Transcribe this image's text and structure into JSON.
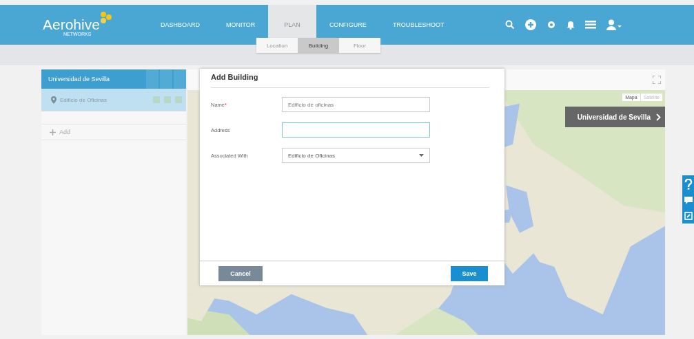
{
  "brand": {
    "name": "Aerohive",
    "tagline": "NETWORKS"
  },
  "nav": [
    {
      "label": "DASHBOARD",
      "selected": false
    },
    {
      "label": "MONITOR",
      "selected": false
    },
    {
      "label": "PLAN",
      "selected": true
    },
    {
      "label": "CONFIGURE",
      "selected": false
    },
    {
      "label": "TROUBLESHOOT",
      "selected": false
    }
  ],
  "subnav": [
    {
      "label": "Location",
      "selected": false
    },
    {
      "label": "Building",
      "selected": true
    },
    {
      "label": "Floor",
      "selected": false
    }
  ],
  "sidebar": {
    "title": "Universidad de Sevilla",
    "items": [
      {
        "label": "Edificio de Oficinas",
        "selected": true
      }
    ],
    "add": "Add"
  },
  "map": {
    "type_buttons": [
      {
        "label": "Mapa",
        "selected": true
      },
      {
        "label": "Satélite",
        "selected": false
      }
    ],
    "overlay": "Universidad de Sevilla"
  },
  "dialog": {
    "title": "Add Building",
    "fields": [
      {
        "kind": "text",
        "label": "Name",
        "required_mark": "*",
        "value": "Edificio de oficinas",
        "focused": false
      },
      {
        "kind": "text",
        "label": "Address",
        "focused": true
      },
      {
        "kind": "select",
        "label": "Associated With",
        "value": "Edificio de Oficinas",
        "focused": false
      }
    ],
    "buttons": [
      {
        "kind": "cancel",
        "label": "Cancel"
      },
      {
        "kind": "save",
        "label": "Save"
      }
    ]
  }
}
